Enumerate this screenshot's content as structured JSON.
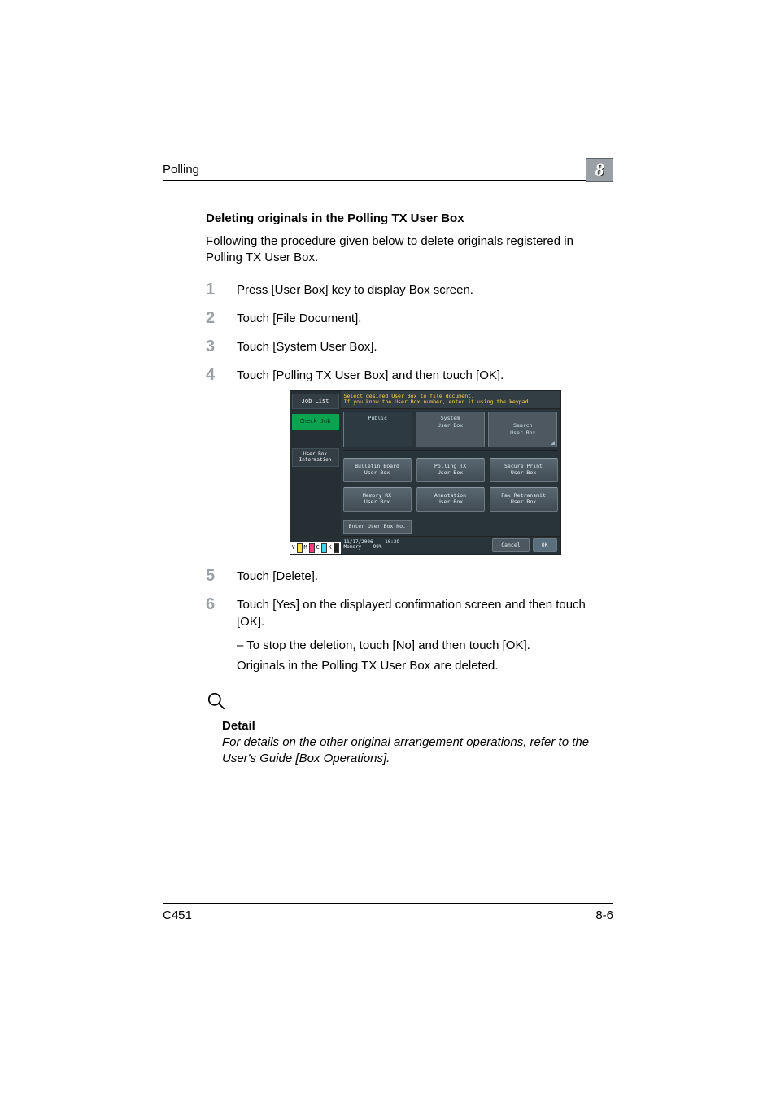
{
  "header": {
    "running_head": "Polling",
    "chapter_number": "8"
  },
  "section": {
    "title": "Deleting originals in the Polling TX User Box",
    "intro": "Following the procedure given below to delete originals registered in Polling TX User Box."
  },
  "steps": {
    "s1": "Press [User Box] key to display Box screen.",
    "s2": "Touch [File Document].",
    "s3": "Touch [System User Box].",
    "s4": "Touch [Polling TX User Box] and then touch [OK].",
    "s5": "Touch [Delete].",
    "s6": "Touch [Yes] on the displayed confirmation screen and then touch [OK].",
    "s6_sub1": "To stop the deletion, touch [No] and then touch [OK].",
    "s6_post": "Originals in the Polling TX User Box are deleted."
  },
  "scr": {
    "prompt": "Select desired User Box to file document.\nIf you know the User Box number, enter it using the keypad.",
    "left": {
      "job_list": "Job List",
      "check_job": "Check Job",
      "ubi_line1": "User Box",
      "ubi_line2": "Information"
    },
    "tabs": {
      "public": "Public",
      "system": "System\nUser Box",
      "search": "Search\nUser Box"
    },
    "boxes": {
      "b1": "Bulletin Board\nUser Box",
      "b2": "Polling TX\nUser Box",
      "b3": "Secure Print\nUser Box",
      "b4": "Memory RX\nUser Box",
      "b5": "Annotation\nUser Box",
      "b6": "Fax Retransmit\nUser Box"
    },
    "enter": "Enter User Box No.",
    "datetime": {
      "date": "11/17/2006",
      "time": "10:39",
      "mem_label": "Memory",
      "mem_val": "99%"
    },
    "cancel": "Cancel",
    "ok": "OK",
    "toner": {
      "y": "Y",
      "m": "M",
      "c": "C",
      "k": "K"
    }
  },
  "detail": {
    "heading": "Detail",
    "body": "For details on the other original arrangement operations, refer to the User's Guide [Box Operations]."
  },
  "footer": {
    "model": "C451",
    "page": "8-6"
  }
}
